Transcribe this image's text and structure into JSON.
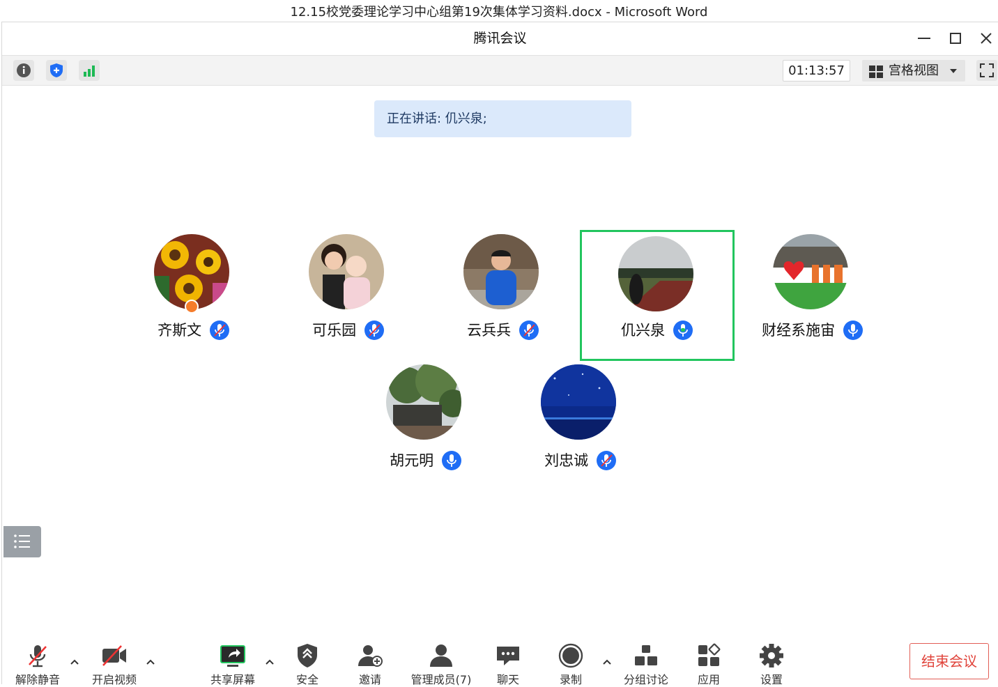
{
  "outer_window": {
    "title": "12.15校党委理论学习中心组第19次集体学习资料.docx - Microsoft Word"
  },
  "app": {
    "title": "腾讯会议"
  },
  "toolbar": {
    "timer": "01:13:57",
    "view_mode": "宫格视图"
  },
  "speaking_banner": "正在讲话: 仉兴泉;",
  "participants": [
    {
      "name": "齐斯文",
      "mic": "muted",
      "host": true
    },
    {
      "name": "可乐园",
      "mic": "muted"
    },
    {
      "name": "云兵兵",
      "mic": "muted"
    },
    {
      "name": "仉兴泉",
      "mic": "on",
      "speaking": true
    },
    {
      "name": "财经系施宙",
      "mic": "on"
    },
    {
      "name": "胡元明",
      "mic": "on"
    },
    {
      "name": "刘忠诚",
      "mic": "muted"
    }
  ],
  "bottom_bar": {
    "unmute": "解除静音",
    "start_video": "开启视频",
    "share_screen": "共享屏幕",
    "security": "安全",
    "invite": "邀请",
    "manage_members": "管理成员(7)",
    "chat": "聊天",
    "record": "录制",
    "breakout": "分组讨论",
    "apps": "应用",
    "settings": "设置",
    "end_meeting": "结束会议"
  },
  "colors": {
    "accent_blue": "#1f6df5",
    "speaking_border": "#22c55e",
    "end_red": "#e0433a",
    "banner_bg": "#dbe9fb"
  }
}
